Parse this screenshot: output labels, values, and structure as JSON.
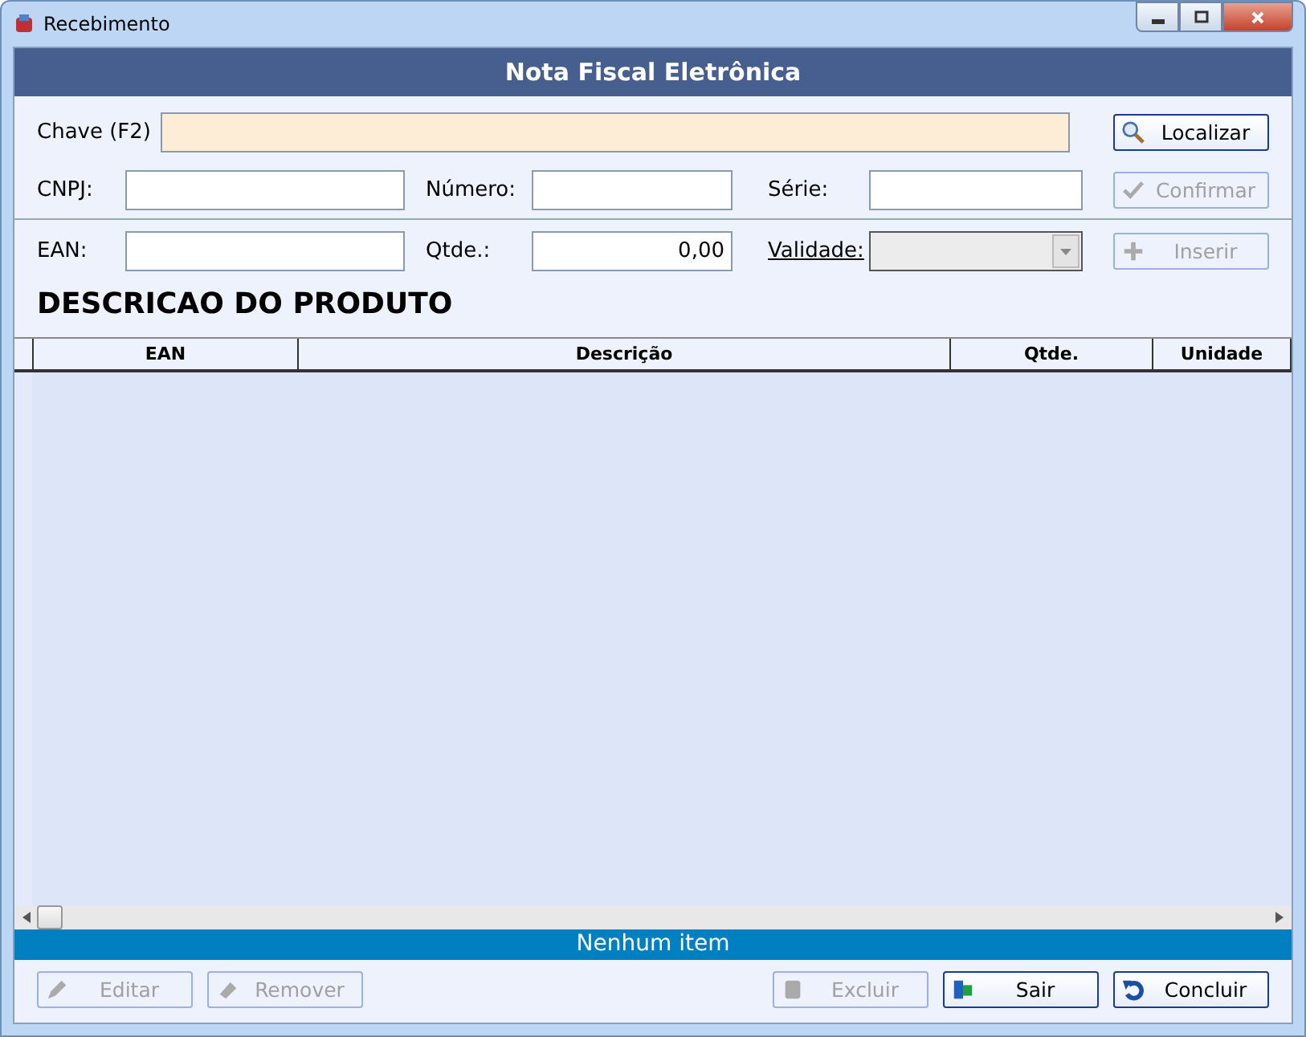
{
  "window": {
    "title": "Recebimento"
  },
  "header": "Nota Fiscal Eletrônica",
  "chave": {
    "label": "Chave (F2)"
  },
  "buttons_top": [
    {
      "label": "Localizar",
      "disabled": false
    },
    {
      "label": "Confirmar",
      "disabled": true
    },
    {
      "label": "Inserir",
      "disabled": true
    }
  ],
  "row1": [
    {
      "label": "CNPJ:"
    },
    {
      "label": "Número:"
    },
    {
      "label": "Série:"
    }
  ],
  "row2": {
    "ean": {
      "label": "EAN:"
    },
    "qtde": {
      "label": "Qtde.:",
      "value": "0,00"
    },
    "validade": {
      "label": "Validade:",
      "disabled": true
    }
  },
  "section_title": "DESCRICAO DO PRODUTO",
  "table": {
    "columns": [
      "EAN",
      "Descrição",
      "Qtde.",
      "Unidade"
    ]
  },
  "status_bar": "Nenhum item",
  "buttons_bottom": [
    {
      "label": "Editar",
      "disabled": true
    },
    {
      "label": "Remover",
      "disabled": true
    },
    {
      "label": "Excluir",
      "disabled": true
    },
    {
      "label": "Sair",
      "disabled": false
    },
    {
      "label": "Concluir",
      "disabled": false
    }
  ]
}
